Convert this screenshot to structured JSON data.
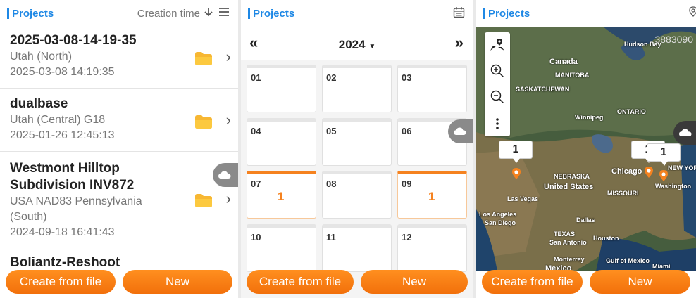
{
  "list_panel": {
    "title": "Projects",
    "sort_label": "Creation time",
    "items": [
      {
        "name": "2025-03-08-14-19-35",
        "zone": "Utah (North)",
        "date": "2025-03-08 14:19:35"
      },
      {
        "name": "dualbase",
        "zone": "Utah (Central) G18",
        "date": "2025-01-26 12:45:13"
      },
      {
        "name": "Westmont Hilltop Subdivision INV872",
        "zone": "USA NAD83 Pennsylvania (South)",
        "date": "2024-09-18 16:41:43"
      },
      {
        "name": "Boliantz-Reshoot",
        "zone": "",
        "date": ""
      }
    ],
    "create_label": "Create from file",
    "new_label": "New"
  },
  "calendar_panel": {
    "title": "Projects",
    "prev": "«",
    "next": "»",
    "year": "2024",
    "months": [
      {
        "label": "01",
        "count": ""
      },
      {
        "label": "02",
        "count": ""
      },
      {
        "label": "03",
        "count": ""
      },
      {
        "label": "04",
        "count": ""
      },
      {
        "label": "05",
        "count": ""
      },
      {
        "label": "06",
        "count": ""
      },
      {
        "label": "07",
        "count": "1"
      },
      {
        "label": "08",
        "count": ""
      },
      {
        "label": "09",
        "count": "1"
      },
      {
        "label": "10",
        "count": ""
      },
      {
        "label": "11",
        "count": ""
      },
      {
        "label": "12",
        "count": ""
      }
    ],
    "create_label": "Create from file",
    "new_label": "New"
  },
  "map_panel": {
    "title": "Projects",
    "scale_text": "3883090",
    "labels": {
      "canada": "Canada",
      "us": "United States",
      "mexico": "Mexico",
      "chicago": "Chicago",
      "winnipeg": "Winnipeg",
      "washington": "Washington",
      "san_diego": "San Diego",
      "los_angeles": "Los Angeles",
      "las_vegas": "Las Vegas",
      "dallas": "Dallas",
      "san_antonio": "San Antonio",
      "houston": "Houston",
      "miami": "Miami",
      "monterrey": "Monterrey",
      "ontario": "ONTARIO",
      "manitoba": "MANITOBA",
      "saskatchewan": "SASKATCHEWAN",
      "new_york": "NEW YORK",
      "missouri": "MISSOURI",
      "texas": "TEXAS",
      "nebraska": "NEBRASKA",
      "gulf": "Gulf of Mexico",
      "hudson": "Hudson Bay"
    },
    "callouts": [
      "1",
      "1",
      "1"
    ],
    "create_label": "Create from file",
    "new_label": "New"
  },
  "colors": {
    "accent": "#1e88e5",
    "orange": "#f5821f"
  }
}
